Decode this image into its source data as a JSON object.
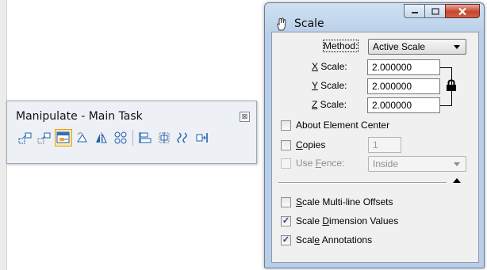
{
  "toolbox": {
    "title": "Manipulate - Main Task",
    "close_glyph": "⊠",
    "tools": [
      {
        "name": "copy-tool-icon"
      },
      {
        "name": "move-tool-icon"
      },
      {
        "name": "scale-tool-icon",
        "active": true
      },
      {
        "name": "rotate-tool-icon"
      },
      {
        "name": "mirror-tool-icon"
      },
      {
        "name": "array-tool-icon"
      },
      {
        "name": "align-edges-tool-icon"
      },
      {
        "name": "stretch-tool-icon"
      },
      {
        "name": "spin-tool-icon"
      },
      {
        "name": "move-to-contact-tool-icon"
      }
    ]
  },
  "scale_window": {
    "title": "Scale",
    "method_label": "Method:",
    "method_value": "Active Scale",
    "x_scale_label_u": "X",
    "x_scale_label_rest": " Scale:",
    "x_scale_value": "2.000000",
    "y_scale_label_u": "Y",
    "y_scale_label_rest": " Scale:",
    "y_scale_value": "2.000000",
    "z_scale_label_u": "Z",
    "z_scale_label_rest": " Scale:",
    "z_scale_value": "2.000000",
    "about_center_label": "About Element Center",
    "about_center_checked": false,
    "copies_label_u": "C",
    "copies_label_rest": "opies",
    "copies_checked": false,
    "copies_value": "1",
    "use_fence_label_pre": "Use ",
    "use_fence_label_u": "F",
    "use_fence_label_rest": "ence:",
    "use_fence_checked": false,
    "fence_mode_value": "Inside",
    "multiline_label_u": "S",
    "multiline_label_rest": "cale Multi-line Offsets",
    "multiline_checked": false,
    "dimension_label_pre": "Scale ",
    "dimension_label_u": "D",
    "dimension_label_rest": "imension Values",
    "dimension_checked": true,
    "annotations_label_pre": "Scal",
    "annotations_label_u": "e",
    "annotations_label_rest": " Annotations",
    "annotations_checked": true,
    "check_glyph": "✓"
  },
  "colors": {
    "accent_active_tool": "#fde7a6",
    "close_button": "#c6452e",
    "window_frame": "#b9cfe8"
  }
}
